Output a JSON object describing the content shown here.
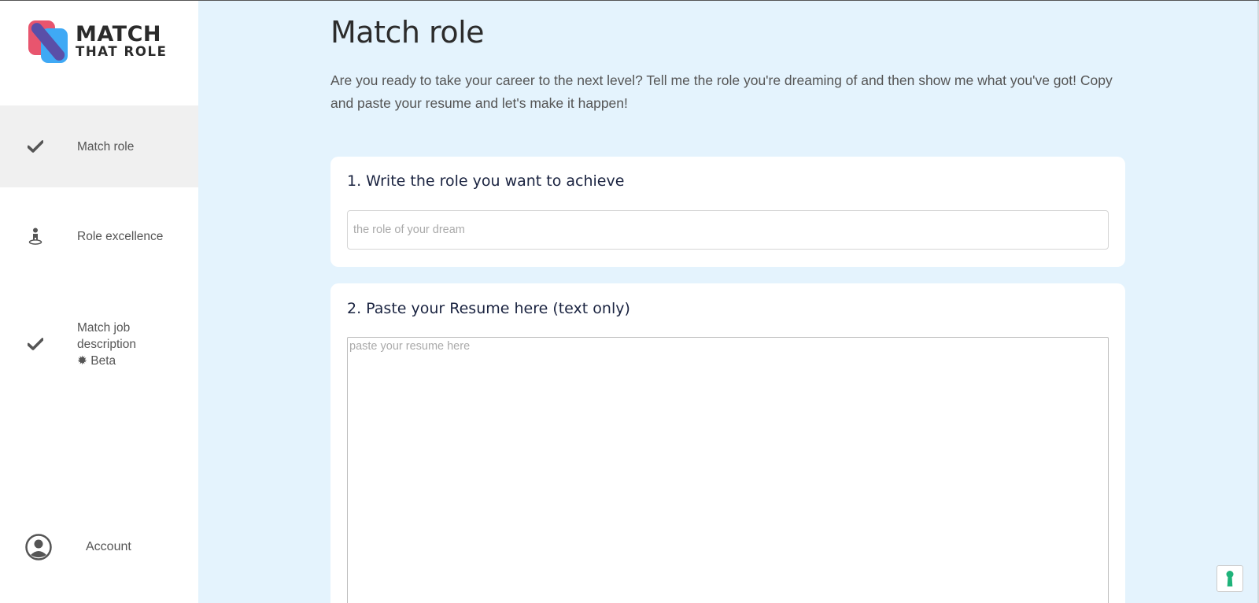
{
  "logo": {
    "line1": "MATCH",
    "line2": "THAT ROLE"
  },
  "sidebar": {
    "items": [
      {
        "label": "Match role",
        "icon": "check-icon",
        "active": true
      },
      {
        "label": "Role excellence",
        "icon": "person-pin-icon",
        "active": false
      },
      {
        "label_lines": [
          "Match job",
          "description",
          "✹ Beta"
        ],
        "icon": "check-icon",
        "active": false
      }
    ],
    "account": {
      "label": "Account",
      "icon": "account-circle-icon"
    }
  },
  "main": {
    "title": "Match role",
    "intro": "Are you ready to take your career to the next level? Tell me the role you're dreaming of and then show me what you've got! Copy and paste your resume and let's make it happen!",
    "role_card": {
      "title": "1. Write the role you want to achieve",
      "placeholder": "the role of your dream",
      "value": ""
    },
    "resume_card": {
      "title": "2. Paste your Resume here (text only)",
      "placeholder": "paste your resume here",
      "value": ""
    }
  },
  "help_button": {
    "icon": "keyhole-icon"
  },
  "colors": {
    "page_background": "#e4f3fd",
    "sidebar_background": "#ffffff",
    "active_item_background": "#f0f0f0",
    "logo_pink": "#e8556e",
    "logo_blue": "#3fa9f5",
    "logo_purple": "#5a4fa8",
    "help_icon": "#1fb37a"
  }
}
